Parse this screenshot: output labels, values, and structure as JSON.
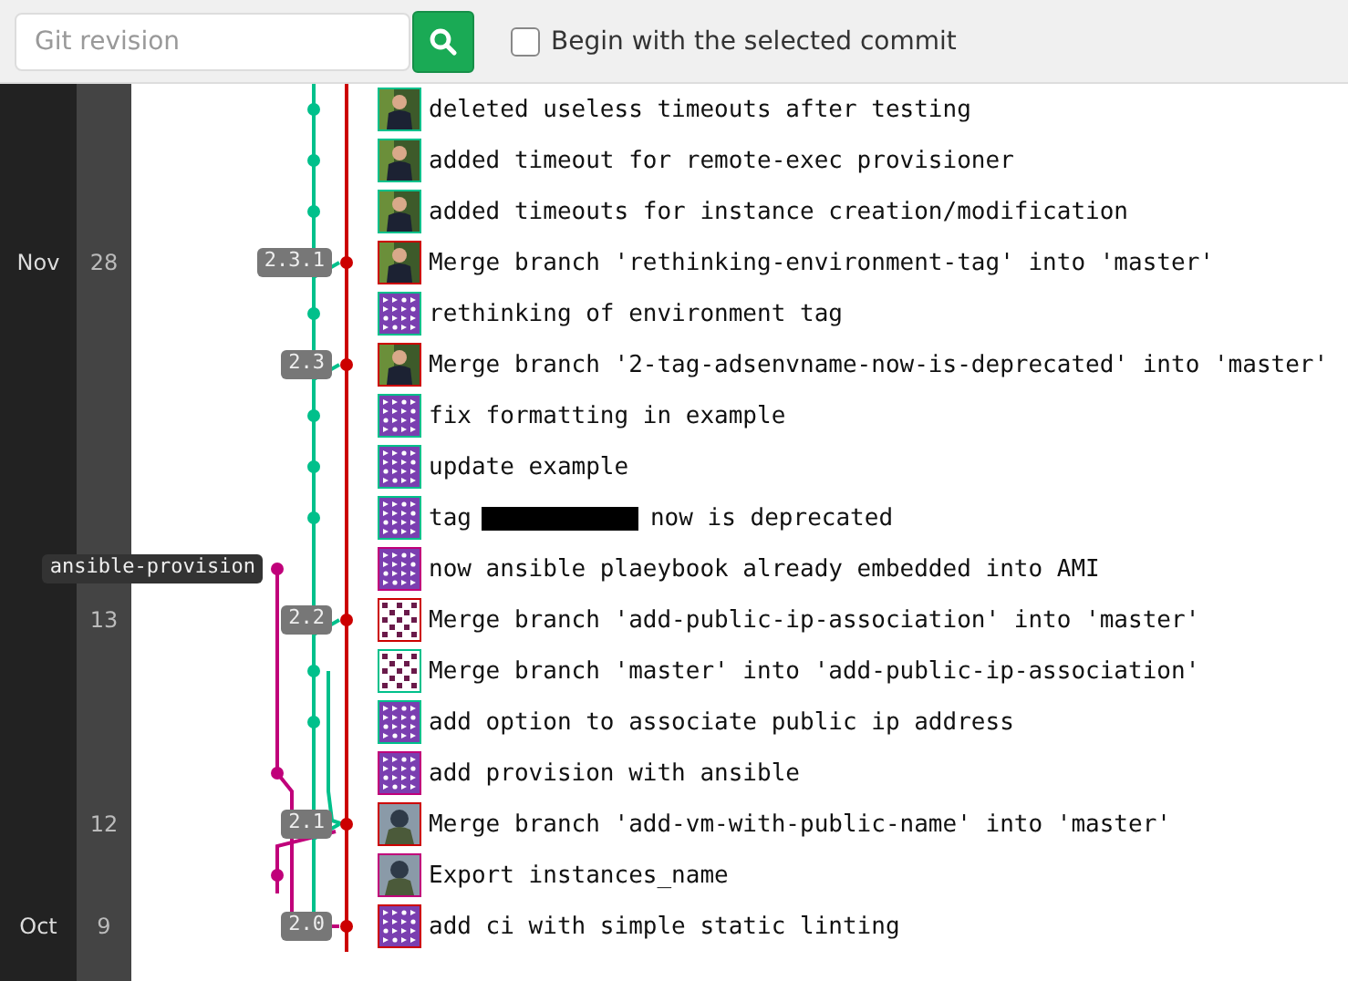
{
  "toolbar": {
    "search": {
      "placeholder": "Git revision"
    },
    "begin_with_selected": {
      "label": "Begin with the selected commit",
      "checked": false
    }
  },
  "commits": [
    {
      "message": "deleted useless timeouts after testing",
      "kind": "feature",
      "avatar": {
        "kind": "photo",
        "color": "#00c08b"
      }
    },
    {
      "message": "added timeout for remote-exec provisioner",
      "kind": "feature",
      "avatar": {
        "kind": "photo",
        "color": "#00c08b"
      }
    },
    {
      "message": "added timeouts for instance creation/modification",
      "kind": "feature",
      "avatar": {
        "kind": "photo",
        "color": "#00c08b"
      }
    },
    {
      "month": "Nov",
      "day": "28",
      "message": "Merge branch 'rethinking-environment-tag' into 'master'",
      "kind": "master",
      "tag": {
        "kind": "version",
        "text": "2.3.1"
      },
      "avatar": {
        "kind": "photo",
        "color": "#cc0000"
      }
    },
    {
      "message": "rethinking of environment tag",
      "kind": "feature",
      "avatar": {
        "kind": "identicon",
        "color": "#00c08b"
      }
    },
    {
      "message": "Merge branch '2-tag-adsenvname-now-is-deprecated' into 'master'",
      "kind": "master",
      "tag": {
        "kind": "version",
        "text": "2.3"
      },
      "avatar": {
        "kind": "photo",
        "color": "#cc0000"
      }
    },
    {
      "message": "fix formatting in example",
      "kind": "feature",
      "avatar": {
        "kind": "identicon",
        "color": "#00c08b"
      }
    },
    {
      "message": "update example",
      "kind": "feature",
      "avatar": {
        "kind": "identicon",
        "color": "#00c08b"
      }
    },
    {
      "message": "tag",
      "redacted": true,
      "message_after": "now is deprecated",
      "kind": "feature",
      "avatar": {
        "kind": "identicon",
        "color": "#00c08b"
      }
    },
    {
      "message": "now ansible plaeybook already embedded into AMI",
      "kind": "provision",
      "tag": {
        "kind": "branch",
        "text": "ansible-provision"
      },
      "avatar": {
        "kind": "identicon",
        "color": "#c0007a"
      }
    },
    {
      "day": "13",
      "message": "Merge branch 'add-public-ip-association' into 'master'",
      "kind": "master",
      "tag": {
        "kind": "version",
        "text": "2.2"
      },
      "avatar": {
        "kind": "dots",
        "color": "#cc0000"
      }
    },
    {
      "message": "Merge branch 'master' into 'add-public-ip-association'",
      "kind": "feature",
      "avatar": {
        "kind": "dots",
        "color": "#00c08b"
      }
    },
    {
      "message": "add option to associate public ip address",
      "kind": "feature",
      "avatar": {
        "kind": "identicon",
        "color": "#00c08b"
      }
    },
    {
      "message": "add provision with ansible",
      "kind": "provision",
      "avatar": {
        "kind": "identicon",
        "color": "#c0007a"
      }
    },
    {
      "day": "12",
      "message": "Merge branch 'add-vm-with-public-name' into 'master'",
      "kind": "master",
      "tag": {
        "kind": "version",
        "text": "2.1"
      },
      "avatar": {
        "kind": "photo2",
        "color": "#cc0000"
      }
    },
    {
      "message": "Export instances_name",
      "kind": "provision",
      "avatar": {
        "kind": "photo2",
        "color": "#c0007a"
      }
    },
    {
      "month": "Oct",
      "day": "9",
      "message": "add ci with simple static linting",
      "kind": "master",
      "tag": {
        "kind": "version",
        "text": "2.0"
      },
      "avatar": {
        "kind": "identicon",
        "color": "#cc0000"
      }
    }
  ]
}
